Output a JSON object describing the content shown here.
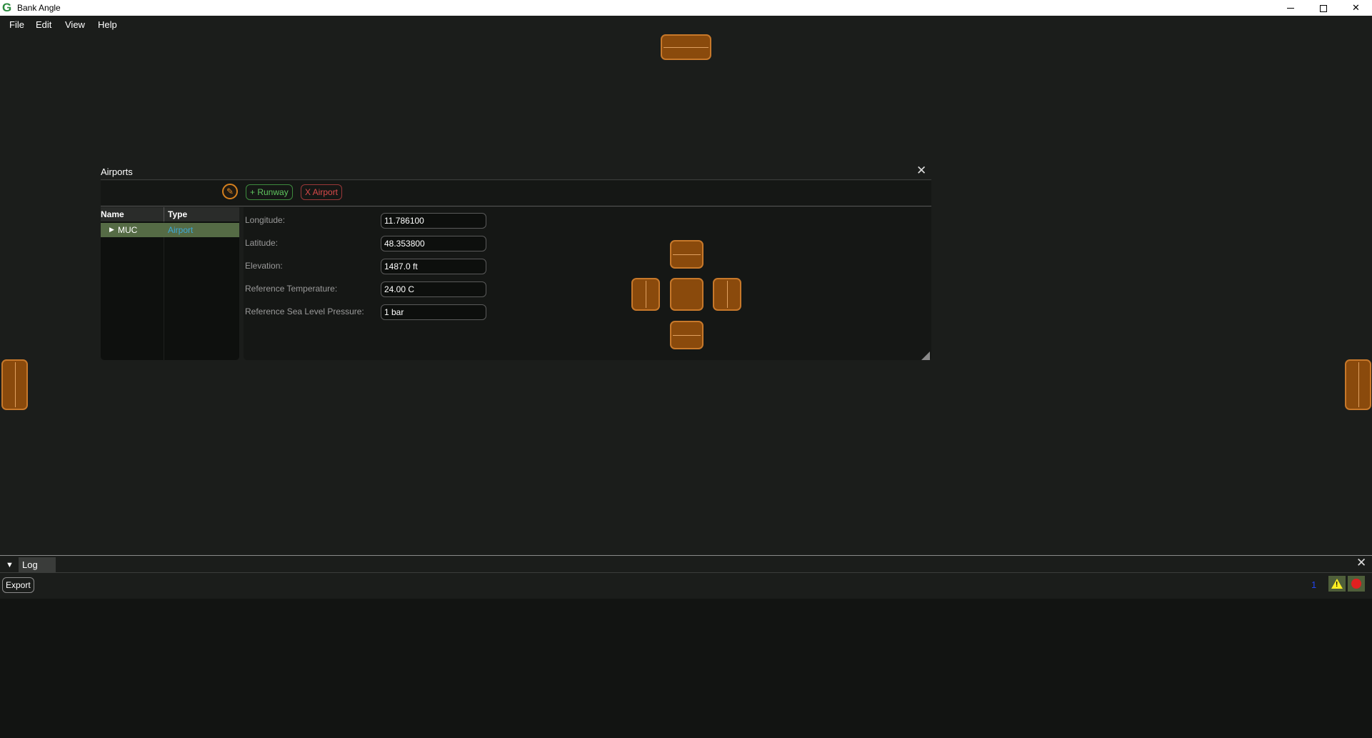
{
  "window": {
    "title": "Bank Angle"
  },
  "menu": {
    "items": [
      "File",
      "Edit",
      "View",
      "Help"
    ]
  },
  "airports_panel": {
    "title": "Airports",
    "toolbar": {
      "add_runway_label": "+ Runway",
      "remove_airport_label": "X Airport"
    },
    "tree": {
      "columns": [
        "Name",
        "Type"
      ],
      "rows": [
        {
          "name": "MUC",
          "type": "Airport"
        }
      ]
    },
    "properties": [
      {
        "label": "Longitude:",
        "value": "11.786100"
      },
      {
        "label": "Latitude:",
        "value": "48.353800"
      },
      {
        "label": "Elevation:",
        "value": "1487.0 ft"
      },
      {
        "label": "Reference Temperature:",
        "value": "24.00 C"
      },
      {
        "label": "Reference Sea Level Pressure:",
        "value": "1 bar"
      }
    ]
  },
  "log_panel": {
    "title": "Log",
    "export_label": "Export",
    "info_count": "1"
  },
  "colors": {
    "background": "#1b1d1b",
    "dock_accent": "#c7782a",
    "selected_row": "#556b45",
    "runway_green": "#5fc65f",
    "airport_red": "#d94a4a",
    "type_blue": "#3da9d9"
  }
}
